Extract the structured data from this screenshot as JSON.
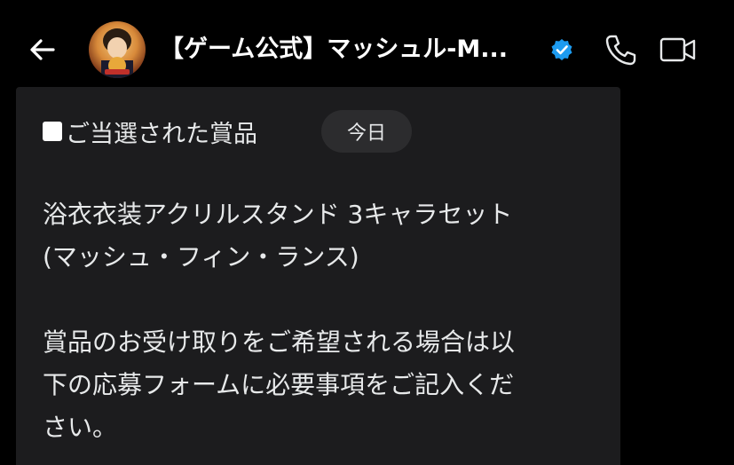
{
  "header": {
    "title": "【ゲーム公式】マッシュル-M...",
    "back_icon": "arrow-left-icon",
    "verified_icon": "verified-badge-icon",
    "call_icon": "phone-icon",
    "video_icon": "video-camera-icon",
    "accent_color": "#1d9bf0"
  },
  "message": {
    "heading": "ご当選された賞品",
    "date_pill": "今日",
    "prize_line1": "浴衣衣装アクリルスタンド 3キャラセット",
    "prize_line2": "(マッシュ・フィン・ランス)",
    "body_line1": "賞品のお受け取りをご希望される場合は以",
    "body_line2": "下の応募フォームに必要事項をご記入くだ",
    "body_line3": "さい。"
  }
}
